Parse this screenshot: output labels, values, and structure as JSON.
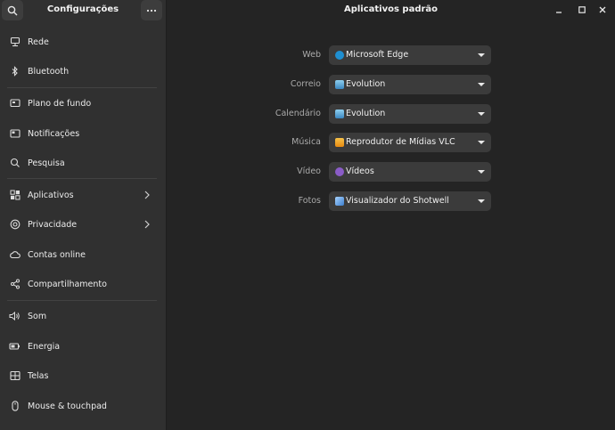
{
  "sidebar": {
    "title": "Configurações",
    "items": [
      {
        "label": "Rede",
        "icon": "network-icon"
      },
      {
        "label": "Bluetooth",
        "icon": "bluetooth-icon"
      },
      {
        "label": "Plano de fundo",
        "icon": "wallpaper-icon"
      },
      {
        "label": "Notificações",
        "icon": "notifications-icon"
      },
      {
        "label": "Pesquisa",
        "icon": "search-icon"
      },
      {
        "label": "Aplicativos",
        "icon": "apps-icon"
      },
      {
        "label": "Privacidade",
        "icon": "privacy-icon"
      },
      {
        "label": "Contas online",
        "icon": "cloud-icon"
      },
      {
        "label": "Compartilhamento",
        "icon": "share-icon"
      },
      {
        "label": "Som",
        "icon": "speaker-icon"
      },
      {
        "label": "Energia",
        "icon": "battery-icon"
      },
      {
        "label": "Telas",
        "icon": "display-icon"
      },
      {
        "label": "Mouse & touchpad",
        "icon": "mouse-icon"
      }
    ]
  },
  "main": {
    "title": "Aplicativos padrão",
    "rows": [
      {
        "label": "Web",
        "value": "Microsoft Edge",
        "icon": "edge-icon",
        "color": "#1f8fd1"
      },
      {
        "label": "Correio",
        "value": "Evolution",
        "icon": "evolution-icon",
        "color": "#5aa8d8"
      },
      {
        "label": "Calendário",
        "value": "Evolution",
        "icon": "evolution-icon",
        "color": "#5aa8d8"
      },
      {
        "label": "Música",
        "value": "Reprodutor de Mídias VLC",
        "icon": "vlc-icon",
        "color": "#f0a020"
      },
      {
        "label": "Vídeo",
        "value": "Vídeos",
        "icon": "videos-icon",
        "color": "#8a5cc7"
      },
      {
        "label": "Fotos",
        "value": "Visualizador do Shotwell",
        "icon": "shotwell-icon",
        "color": "#4a90d9"
      }
    ]
  },
  "colors": {
    "sidebar_bg": "#303030",
    "main_bg": "#242424",
    "dropdown_bg": "#3b3b3b"
  }
}
